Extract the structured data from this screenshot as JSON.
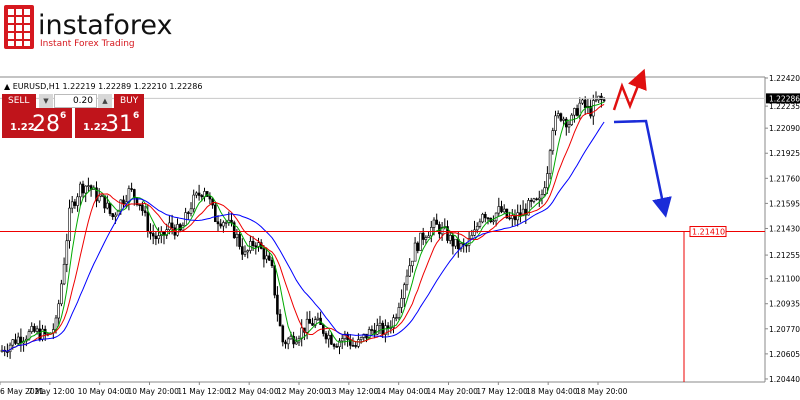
{
  "brand": {
    "name": "instaforex",
    "tagline": "Instant Forex Trading"
  },
  "colors": {
    "candle": "#000000",
    "ma_fast": "#00aa00",
    "ma_mid": "#ee0000",
    "ma_slow": "#0000ff",
    "level": "#ee0000",
    "forecast_down": "#1a2bd8",
    "forecast_up": "#e01010",
    "sell_panel": "#c0141b"
  },
  "header": {
    "symbol": "EURUSD,H1",
    "ohlc": "1.22219 1.22289 1.22210 1.22286"
  },
  "trade_panel": {
    "sell_label": "SELL",
    "buy_label": "BUY",
    "lot": "0.20",
    "sell_price_big": "1.22",
    "sell_price_pips": "28",
    "sell_price_frac": "6",
    "buy_price_big": "1.22",
    "buy_price_pips": "31",
    "buy_price_frac": "6"
  },
  "chart_data": {
    "type": "candlestick",
    "symbol": "EURUSD",
    "timeframe": "H1",
    "ylim": [
      1.2042,
      1.2242
    ],
    "y_ticks": [
      "1.22420",
      "1.22235",
      "1.22090",
      "1.21925",
      "1.21760",
      "1.21595",
      "1.21430",
      "1.21255",
      "1.21100",
      "1.20935",
      "1.20770",
      "1.20605",
      "1.20440"
    ],
    "x_ticks": [
      "6 May 2021",
      "7 May 12:00",
      "10 May 04:00",
      "10 May 20:00",
      "11 May 12:00",
      "12 May 04:00",
      "12 May 20:00",
      "13 May 12:00",
      "14 May 04:00",
      "14 May 20:00",
      "17 May 12:00",
      "18 May 04:00",
      "18 May 20:00"
    ],
    "current_price": "1.22286",
    "level": {
      "value": 1.2141,
      "label": "1.21410"
    },
    "moving_averages": [
      "ma_fast",
      "ma_mid",
      "ma_slow"
    ],
    "path": [
      {
        "t": 0,
        "p": 1.2062
      },
      {
        "t": 18,
        "p": 1.2071
      },
      {
        "t": 35,
        "p": 1.2075
      },
      {
        "t": 48,
        "p": 1.2072
      },
      {
        "t": 56,
        "p": 1.208
      },
      {
        "t": 62,
        "p": 1.211
      },
      {
        "t": 70,
        "p": 1.2155
      },
      {
        "t": 80,
        "p": 1.217
      },
      {
        "t": 88,
        "p": 1.2172
      },
      {
        "t": 95,
        "p": 1.2165
      },
      {
        "t": 105,
        "p": 1.216
      },
      {
        "t": 112,
        "p": 1.215
      },
      {
        "t": 120,
        "p": 1.216
      },
      {
        "t": 130,
        "p": 1.2168
      },
      {
        "t": 140,
        "p": 1.216
      },
      {
        "t": 150,
        "p": 1.214
      },
      {
        "t": 160,
        "p": 1.2135
      },
      {
        "t": 170,
        "p": 1.2145
      },
      {
        "t": 180,
        "p": 1.214
      },
      {
        "t": 192,
        "p": 1.216
      },
      {
        "t": 205,
        "p": 1.217
      },
      {
        "t": 215,
        "p": 1.215
      },
      {
        "t": 225,
        "p": 1.2148
      },
      {
        "t": 235,
        "p": 1.214
      },
      {
        "t": 245,
        "p": 1.2125
      },
      {
        "t": 255,
        "p": 1.2135
      },
      {
        "t": 265,
        "p": 1.2125
      },
      {
        "t": 272,
        "p": 1.2115
      },
      {
        "t": 278,
        "p": 1.2085
      },
      {
        "t": 283,
        "p": 1.2068
      },
      {
        "t": 295,
        "p": 1.2072
      },
      {
        "t": 305,
        "p": 1.2078
      },
      {
        "t": 315,
        "p": 1.2082
      },
      {
        "t": 325,
        "p": 1.2075
      },
      {
        "t": 335,
        "p": 1.2068
      },
      {
        "t": 345,
        "p": 1.2072
      },
      {
        "t": 355,
        "p": 1.2065
      },
      {
        "t": 365,
        "p": 1.2072
      },
      {
        "t": 375,
        "p": 1.2078
      },
      {
        "t": 385,
        "p": 1.2075
      },
      {
        "t": 395,
        "p": 1.2085
      },
      {
        "t": 405,
        "p": 1.211
      },
      {
        "t": 415,
        "p": 1.213
      },
      {
        "t": 425,
        "p": 1.214
      },
      {
        "t": 435,
        "p": 1.2145
      },
      {
        "t": 445,
        "p": 1.214
      },
      {
        "t": 455,
        "p": 1.2132
      },
      {
        "t": 465,
        "p": 1.213
      },
      {
        "t": 475,
        "p": 1.214
      },
      {
        "t": 482,
        "p": 1.2155
      },
      {
        "t": 490,
        "p": 1.215
      },
      {
        "t": 500,
        "p": 1.2155
      },
      {
        "t": 510,
        "p": 1.2148
      },
      {
        "t": 520,
        "p": 1.2152
      },
      {
        "t": 530,
        "p": 1.2158
      },
      {
        "t": 540,
        "p": 1.216
      },
      {
        "t": 547,
        "p": 1.218
      },
      {
        "t": 552,
        "p": 1.221
      },
      {
        "t": 560,
        "p": 1.2218
      },
      {
        "t": 570,
        "p": 1.2212
      },
      {
        "t": 580,
        "p": 1.2225
      },
      {
        "t": 590,
        "p": 1.222
      },
      {
        "t": 598,
        "p": 1.2228
      },
      {
        "t": 605,
        "p": 1.2226
      }
    ]
  }
}
